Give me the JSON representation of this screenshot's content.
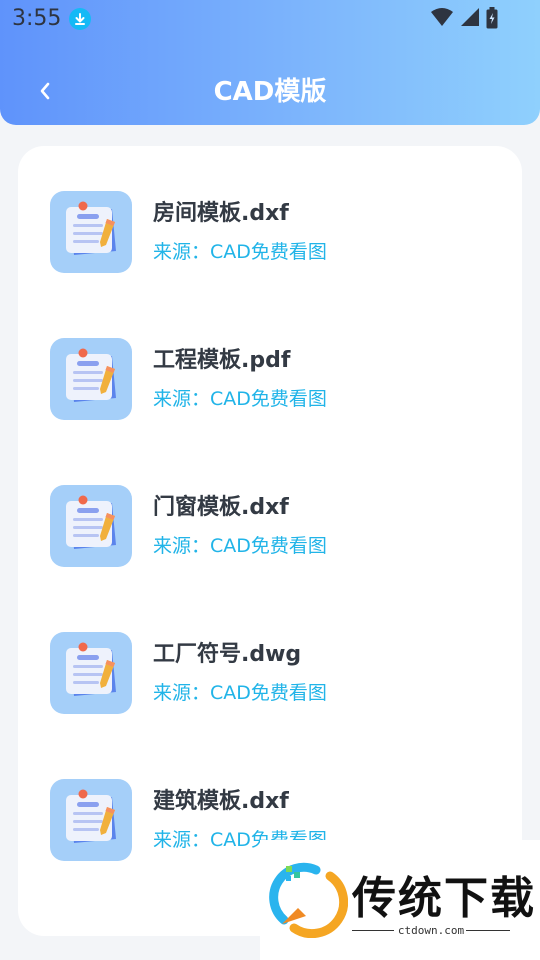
{
  "status_bar": {
    "time": "3:55"
  },
  "header": {
    "title": "CAD模版"
  },
  "items": [
    {
      "name": "房间模板.dxf",
      "source": "来源：CAD免费看图"
    },
    {
      "name": "工程模板.pdf",
      "source": "来源：CAD免费看图"
    },
    {
      "name": "门窗模板.dxf",
      "source": "来源：CAD免费看图"
    },
    {
      "name": "工厂符号.dwg",
      "source": "来源：CAD免费看图"
    },
    {
      "name": "建筑模板.dxf",
      "source": "来源：CAD免费看图"
    }
  ],
  "watermark": {
    "brand": "传统下载",
    "domain": "ctdown.com"
  },
  "colors": {
    "header_start": "#5f93fb",
    "header_end": "#8fd0fd",
    "source_text": "#21b4e8",
    "thumb_bg": "#a5cff9"
  },
  "icons": {
    "back": "chevron-left-icon",
    "file": "document-pencil-icon"
  }
}
